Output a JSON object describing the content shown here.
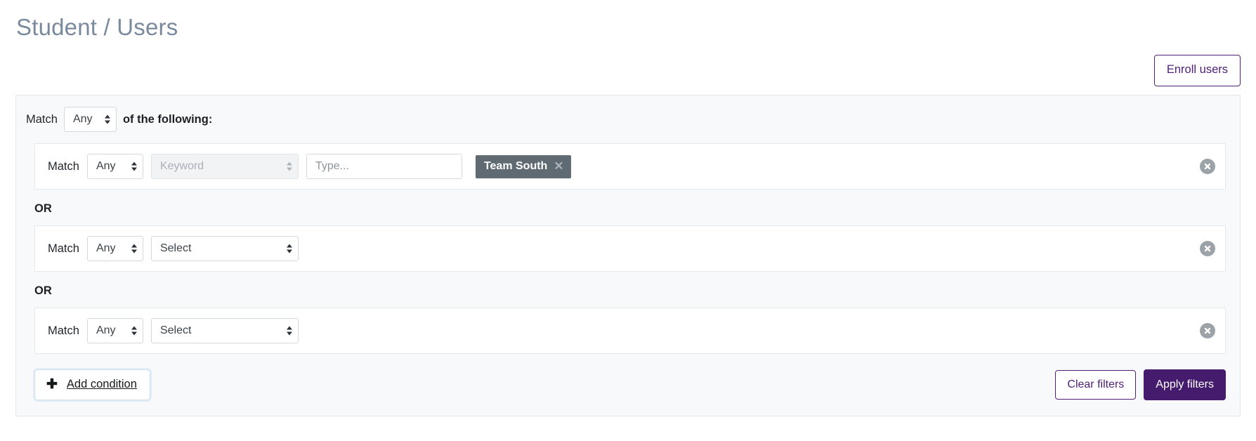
{
  "page": {
    "title": "Student / Users"
  },
  "toolbar": {
    "enroll_users_label": "Enroll users"
  },
  "filter_panel": {
    "match_label": "Match",
    "match_value": "Any",
    "of_the_following_label": "of the following:",
    "separator_label": "OR",
    "conditions": [
      {
        "match_label": "Match",
        "match_value": "Any",
        "field_value": "Keyword",
        "field_disabled": true,
        "input_placeholder": "Type...",
        "input_value": "",
        "tag": {
          "label": "Team South",
          "remove_icon": "close-icon"
        },
        "remove_icon": "remove-circle-icon"
      },
      {
        "match_label": "Match",
        "match_value": "Any",
        "field_value": "Select",
        "field_disabled": false,
        "remove_icon": "remove-circle-icon"
      },
      {
        "match_label": "Match",
        "match_value": "Any",
        "field_value": "Select",
        "field_disabled": false,
        "remove_icon": "remove-circle-icon"
      }
    ],
    "footer": {
      "add_condition_label": "Add condition",
      "add_condition_icon": "plus-icon",
      "clear_filters_label": "Clear filters",
      "apply_filters_label": "Apply filters"
    }
  },
  "colors": {
    "purple": "#451c6d",
    "purple_outline": "#4f2277",
    "title_gray": "#7a8a9e",
    "tag_bg": "#5f6a72",
    "panel_bg": "#f7f9fb"
  }
}
